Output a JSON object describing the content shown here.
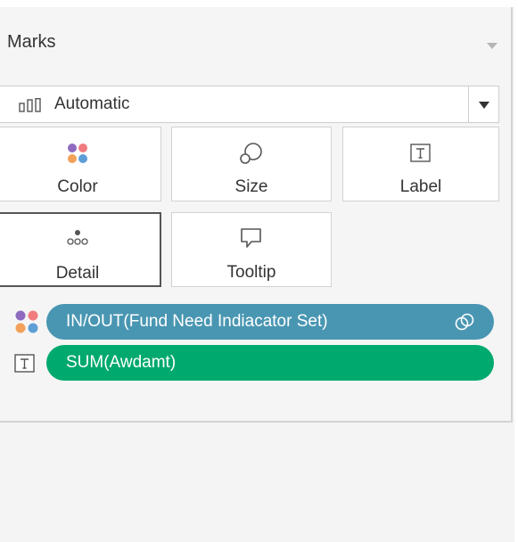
{
  "marks": {
    "title": "Marks",
    "mark_type": {
      "label": "Automatic",
      "icon": "bar-chart-icon"
    },
    "cards": [
      {
        "label": "Color",
        "icon": "color-dots-icon"
      },
      {
        "label": "Size",
        "icon": "size-bubble-icon"
      },
      {
        "label": "Label",
        "icon": "text-label-icon"
      },
      {
        "label": "Detail",
        "icon": "detail-dots-icon"
      },
      {
        "label": "Tooltip",
        "icon": "tooltip-speech-icon"
      }
    ],
    "fields": [
      {
        "encoding": "color",
        "label": "IN/OUT(Fund Need Indiacator Set)",
        "icon": "set-icon",
        "color": "#4996b2"
      },
      {
        "encoding": "label",
        "label": "SUM(Awdamt)",
        "color": "#00a96d"
      }
    ],
    "color_dots": [
      "#8e6bbf",
      "#f07c7e",
      "#f3a15a",
      "#5e9ed6"
    ]
  }
}
